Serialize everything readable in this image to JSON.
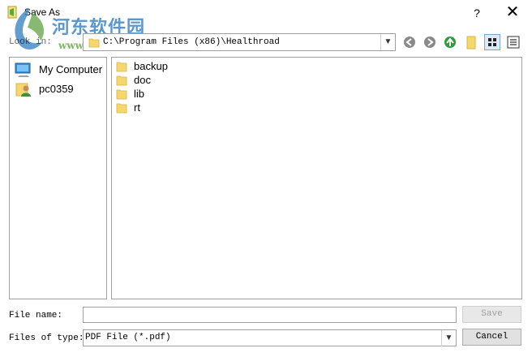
{
  "window": {
    "title": "Save As",
    "help_label": "?",
    "close_label": "✕"
  },
  "watermark": {
    "line1": "河东软件园",
    "line2": "www.pc0359.cn"
  },
  "toolbar": {
    "look_in_label": "Look in:",
    "look_in_path": "C:\\Program Files (x86)\\Healthroad",
    "dropdown_arrow": "⌄",
    "icons": [
      "back-arrow-icon",
      "forward-arrow-icon",
      "up-folder-icon",
      "new-folder-icon",
      "list-view-icon",
      "details-view-icon"
    ]
  },
  "places": [
    {
      "label": "My Computer",
      "icon": "computer-icon"
    },
    {
      "label": "pc0359",
      "icon": "user-icon"
    }
  ],
  "files": [
    {
      "name": "backup",
      "icon": "folder-icon"
    },
    {
      "name": "doc",
      "icon": "folder-icon"
    },
    {
      "name": "lib",
      "icon": "folder-icon"
    },
    {
      "name": "rt",
      "icon": "folder-icon"
    }
  ],
  "form": {
    "file_name_label": "File name:",
    "file_name_value": "",
    "files_of_type_label": "Files of type:",
    "files_of_type_value": "PDF File (*.pdf)",
    "save_label": "Save",
    "cancel_label": "Cancel"
  },
  "colors": {
    "nav_arrow": "#8a8a8a",
    "up_arrow": "#2e9b3a",
    "folder": "#f5d76e",
    "selection": "#dce9f7"
  }
}
